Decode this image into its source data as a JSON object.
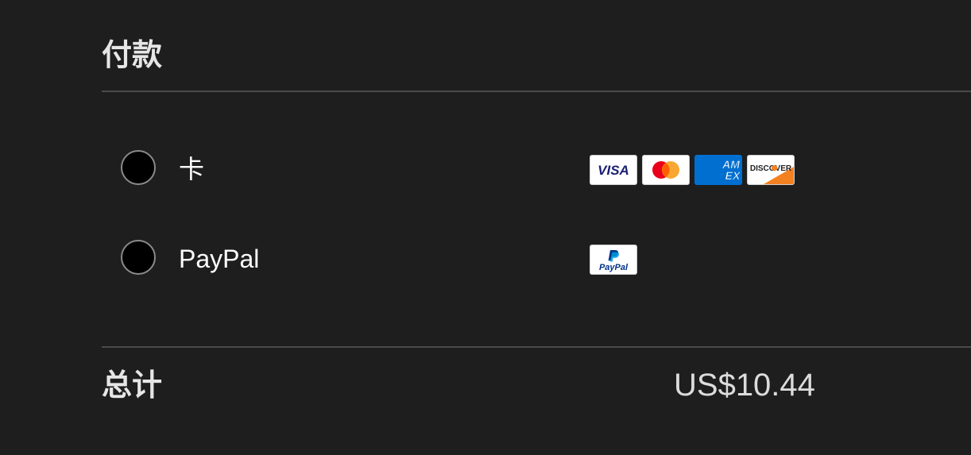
{
  "payment": {
    "title": "付款",
    "options": [
      {
        "label": "卡",
        "selected": false,
        "logos": [
          "visa-logo",
          "mastercard-logo",
          "amex-logo",
          "discover-logo"
        ]
      },
      {
        "label": "PayPal",
        "selected": false,
        "logos": [
          "paypal-logo"
        ]
      }
    ]
  },
  "logos": {
    "visa": "VISA",
    "amex_top": "AM",
    "amex_bottom": "EX",
    "discover": "DISCOVER",
    "paypal": "PayPal"
  },
  "total": {
    "label": "总计",
    "amount": "US$10.44"
  },
  "colors": {
    "background": "#1e1e1e",
    "visa_blue": "#1a1f71",
    "mastercard_red": "#eb001b",
    "mastercard_orange": "#f79e1b",
    "amex_blue": "#016fd0",
    "discover_orange": "#f48120",
    "paypal_dark": "#003087",
    "paypal_light": "#009cde"
  }
}
